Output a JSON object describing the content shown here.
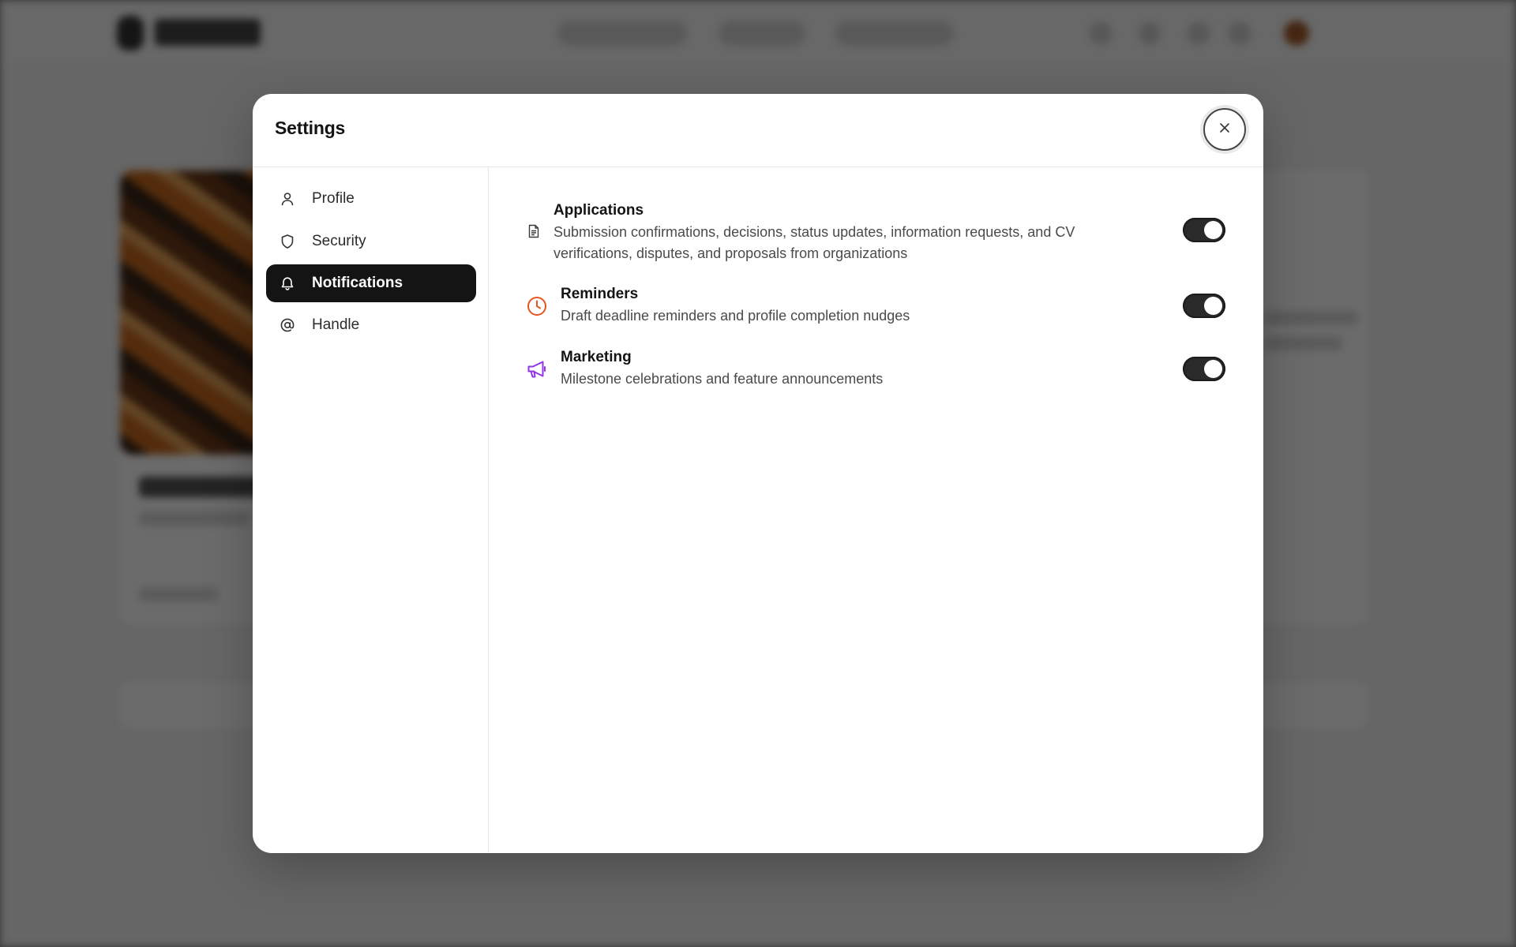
{
  "modal": {
    "title": "Settings",
    "close_icon": "close-icon"
  },
  "sidebar": {
    "items": [
      {
        "label": "Profile",
        "icon": "user-icon",
        "active": false
      },
      {
        "label": "Security",
        "icon": "shield-icon",
        "active": false
      },
      {
        "label": "Notifications",
        "icon": "bell-icon",
        "active": true
      },
      {
        "label": "Handle",
        "icon": "at-sign-icon",
        "active": false
      }
    ]
  },
  "notifications": [
    {
      "title": "Applications",
      "description": "Submission confirmations, decisions, status updates, information requests, and CV verifications, disputes, and proposals from organizations",
      "icon": "document-icon",
      "icon_color": "#3a3a3a",
      "enabled": true
    },
    {
      "title": "Reminders",
      "description": "Draft deadline reminders and profile completion nudges",
      "icon": "clock-icon",
      "icon_color": "#e8541e",
      "enabled": true
    },
    {
      "title": "Marketing",
      "description": "Milestone celebrations and feature announcements",
      "icon": "megaphone-icon",
      "icon_color": "#9333ea",
      "enabled": true
    }
  ],
  "colors": {
    "active_nav_bg": "#141414",
    "toggle_on": "#2a2a2a"
  }
}
